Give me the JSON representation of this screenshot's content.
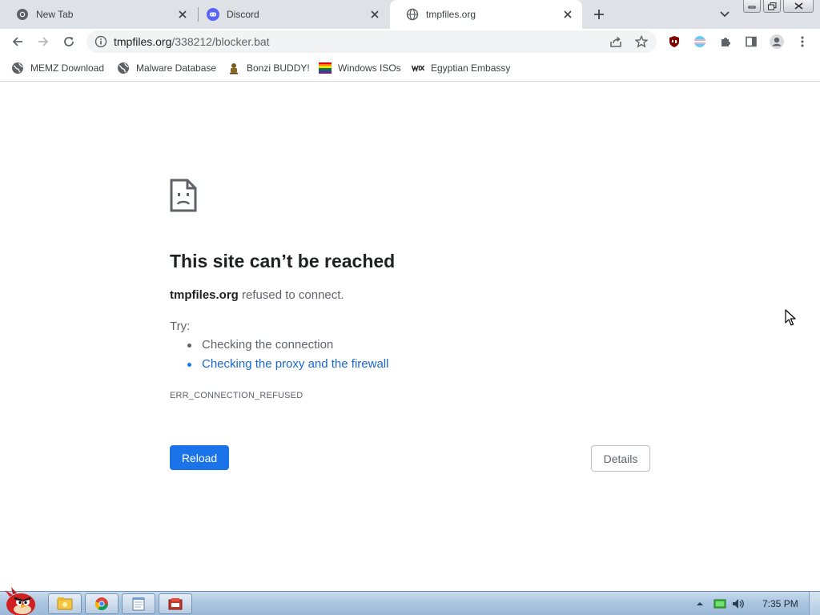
{
  "colors": {
    "tabstrip_bg": "#dee1e6",
    "accent_blue": "#1a73e8",
    "link_blue": "#1967d2",
    "text_primary": "#202124",
    "text_secondary": "#5f6368"
  },
  "tabs": [
    {
      "title": "New Tab",
      "icon": "chrome-icon",
      "active": false
    },
    {
      "title": "Discord",
      "icon": "discord-icon",
      "active": false
    },
    {
      "title": "tmpfiles.org",
      "icon": "globe-icon",
      "active": true
    }
  ],
  "omnibox": {
    "host": "tmpfiles.org",
    "path": "/338212/blocker.bat",
    "icon": "info-icon"
  },
  "bookmarks": [
    {
      "label": "MEMZ Download",
      "icon": "globe-icon"
    },
    {
      "label": "Malware Database",
      "icon": "globe-icon"
    },
    {
      "label": "Bonzi BUDDY!",
      "icon": "bonzi-icon"
    },
    {
      "label": "Windows ISOs",
      "icon": "rainbow-flag-icon"
    },
    {
      "label": "Egyptian Embassy",
      "icon": "wix-icon"
    }
  ],
  "error": {
    "title": "This site can’t be reached",
    "host": "tmpfiles.org",
    "message": " refused to connect.",
    "try_label": "Try:",
    "suggestions": [
      "Checking the connection",
      "Checking the proxy and the firewall"
    ],
    "code": "ERR_CONNECTION_REFUSED",
    "reload_label": "Reload",
    "details_label": "Details"
  },
  "taskbar": {
    "clock": "7:35 PM",
    "items": [
      "explorer-icon",
      "chrome-icon",
      "notepad-icon",
      "app-icon"
    ]
  }
}
